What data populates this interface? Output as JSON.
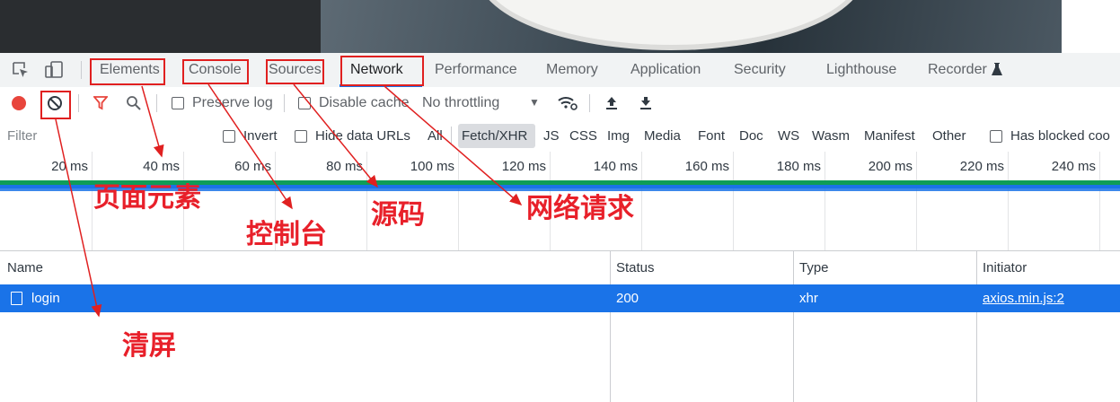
{
  "tabs": [
    "Elements",
    "Console",
    "Sources",
    "Network",
    "Performance",
    "Memory",
    "Application",
    "Security",
    "Lighthouse",
    "Recorder"
  ],
  "toolbar": {
    "preserve_log": "Preserve log",
    "disable_cache": "Disable cache",
    "throttling": "No throttling",
    "throttling_arrow": "▼"
  },
  "filter": {
    "placeholder": "Filter",
    "invert": "Invert",
    "hide_data_urls": "Hide data URLs",
    "types": [
      "All",
      "Fetch/XHR",
      "JS",
      "CSS",
      "Img",
      "Media",
      "Font",
      "Doc",
      "WS",
      "Wasm",
      "Manifest",
      "Other"
    ],
    "has_blocked": "Has blocked coo"
  },
  "timeline": {
    "ticks": [
      "20 ms",
      "40 ms",
      "60 ms",
      "80 ms",
      "100 ms",
      "120 ms",
      "140 ms",
      "160 ms",
      "180 ms",
      "200 ms",
      "220 ms",
      "240 ms"
    ]
  },
  "table": {
    "columns": [
      "Name",
      "Status",
      "Type",
      "Initiator"
    ],
    "rows": [
      {
        "name": "login",
        "status": "200",
        "type": "xhr",
        "initiator": "axios.min.js:2"
      }
    ]
  },
  "annotations": {
    "elements": "页面元素",
    "console": "控制台",
    "sources": "源码",
    "network": "网络请求",
    "clear": "清屏"
  },
  "colors": {
    "accent": "#1a73e8",
    "record": "#e8453c",
    "annotation": "#e8202a",
    "timeline_green": "#0f9d58"
  },
  "icons": [
    "inspect-icon",
    "device-toggle-icon",
    "record-icon",
    "clear-icon",
    "filter-icon",
    "search-icon",
    "wifi-settings-icon",
    "upload-icon",
    "download-icon",
    "flask-icon",
    "checkbox-icon"
  ]
}
